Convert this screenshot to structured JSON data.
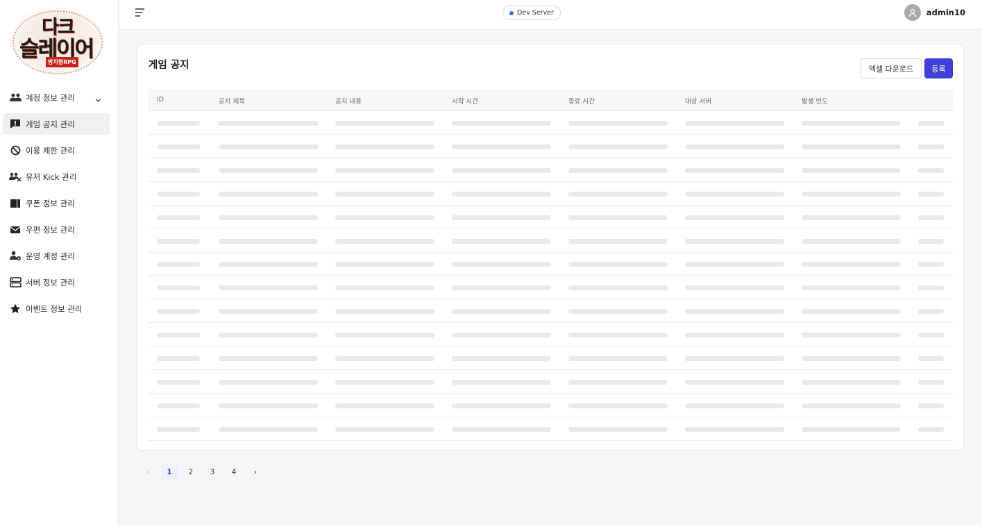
{
  "logo": {
    "line1": "다크",
    "line2": "슬레이어",
    "tag": "방치형RPG"
  },
  "sidebar": {
    "items": [
      {
        "label": "계정 정보 관리",
        "icon": "users-icon",
        "active": false,
        "has_chevron": true
      },
      {
        "label": "게임 공지 관리",
        "icon": "notice-icon",
        "active": true,
        "has_chevron": false
      },
      {
        "label": "이용 제한 관리",
        "icon": "ban-icon",
        "active": false,
        "has_chevron": false
      },
      {
        "label": "유저 Kick 관리",
        "icon": "user-kick-icon",
        "active": false,
        "has_chevron": false
      },
      {
        "label": "쿠폰 정보 관리",
        "icon": "coupon-icon",
        "active": false,
        "has_chevron": false
      },
      {
        "label": "우편 정보 관리",
        "icon": "mail-icon",
        "active": false,
        "has_chevron": false
      },
      {
        "label": "운영 계정 관리",
        "icon": "user-gear-icon",
        "active": false,
        "has_chevron": false
      },
      {
        "label": "서버 정보 관리",
        "icon": "server-icon",
        "active": false,
        "has_chevron": false
      },
      {
        "label": "이벤트 정보 관리",
        "icon": "star-icon",
        "active": false,
        "has_chevron": false
      }
    ]
  },
  "header": {
    "server_label": "Dev Server",
    "username": "admin10"
  },
  "main": {
    "title": "게임 공지",
    "excel_button": "엑셀 다운로드",
    "register_button": "등록",
    "columns": [
      "ID",
      "공지 제목",
      "공지 내용",
      "시작 시간",
      "종료 시간",
      "대상 서버",
      "발생 빈도"
    ],
    "loading_row_count": 14
  },
  "pagination": {
    "prev": "‹",
    "pages": [
      "1",
      "2",
      "3",
      "4"
    ],
    "current": "1",
    "next": "›"
  },
  "colors": {
    "accent": "#4040d8",
    "server_dot": "#3a6ff0",
    "skeleton": "#e9e9ec"
  }
}
